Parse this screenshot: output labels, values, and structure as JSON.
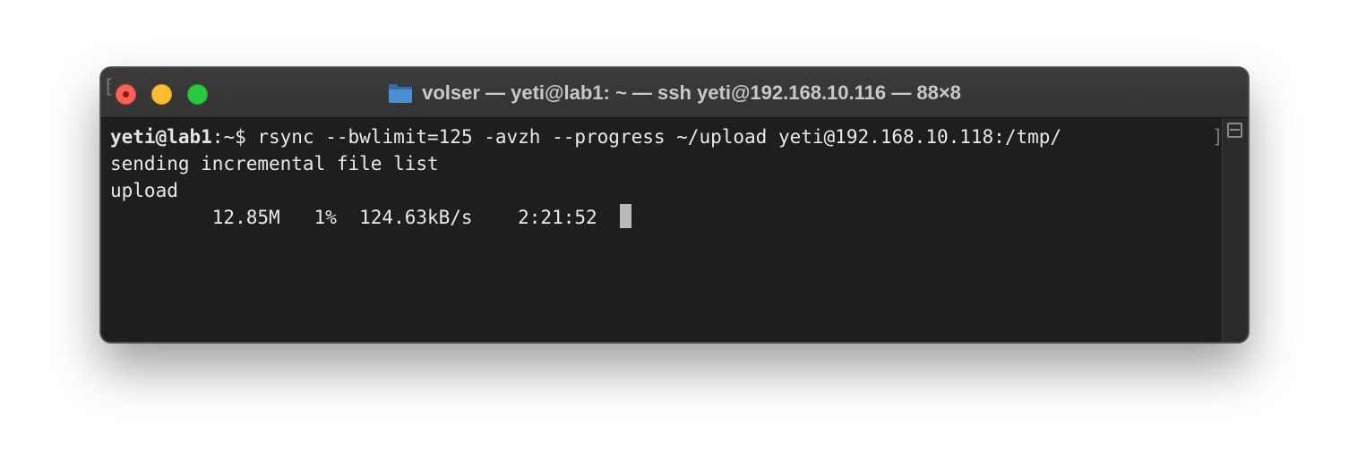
{
  "window": {
    "title": "volser — yeti@lab1: ~ — ssh yeti@192.168.10.116 — 88×8"
  },
  "terminal": {
    "prompt_user": "yeti@lab1",
    "prompt_suffix": ":~$ ",
    "command": "rsync --bwlimit=125 -avzh --progress ~/upload yeti@192.168.10.118:/tmp/",
    "output": [
      "sending incremental file list",
      "upload",
      "         12.85M   1%  124.63kB/s    2:21:52  "
    ],
    "left_bracket": "[",
    "right_bracket": "]"
  },
  "colors": {
    "background": "#1e1e1e",
    "close": "#fe5f57",
    "minimize": "#febc2e",
    "zoom": "#28c840",
    "folder": "#3a7fc1"
  },
  "icons": {
    "folder": "folder-icon",
    "split": "split-pane-icon"
  }
}
